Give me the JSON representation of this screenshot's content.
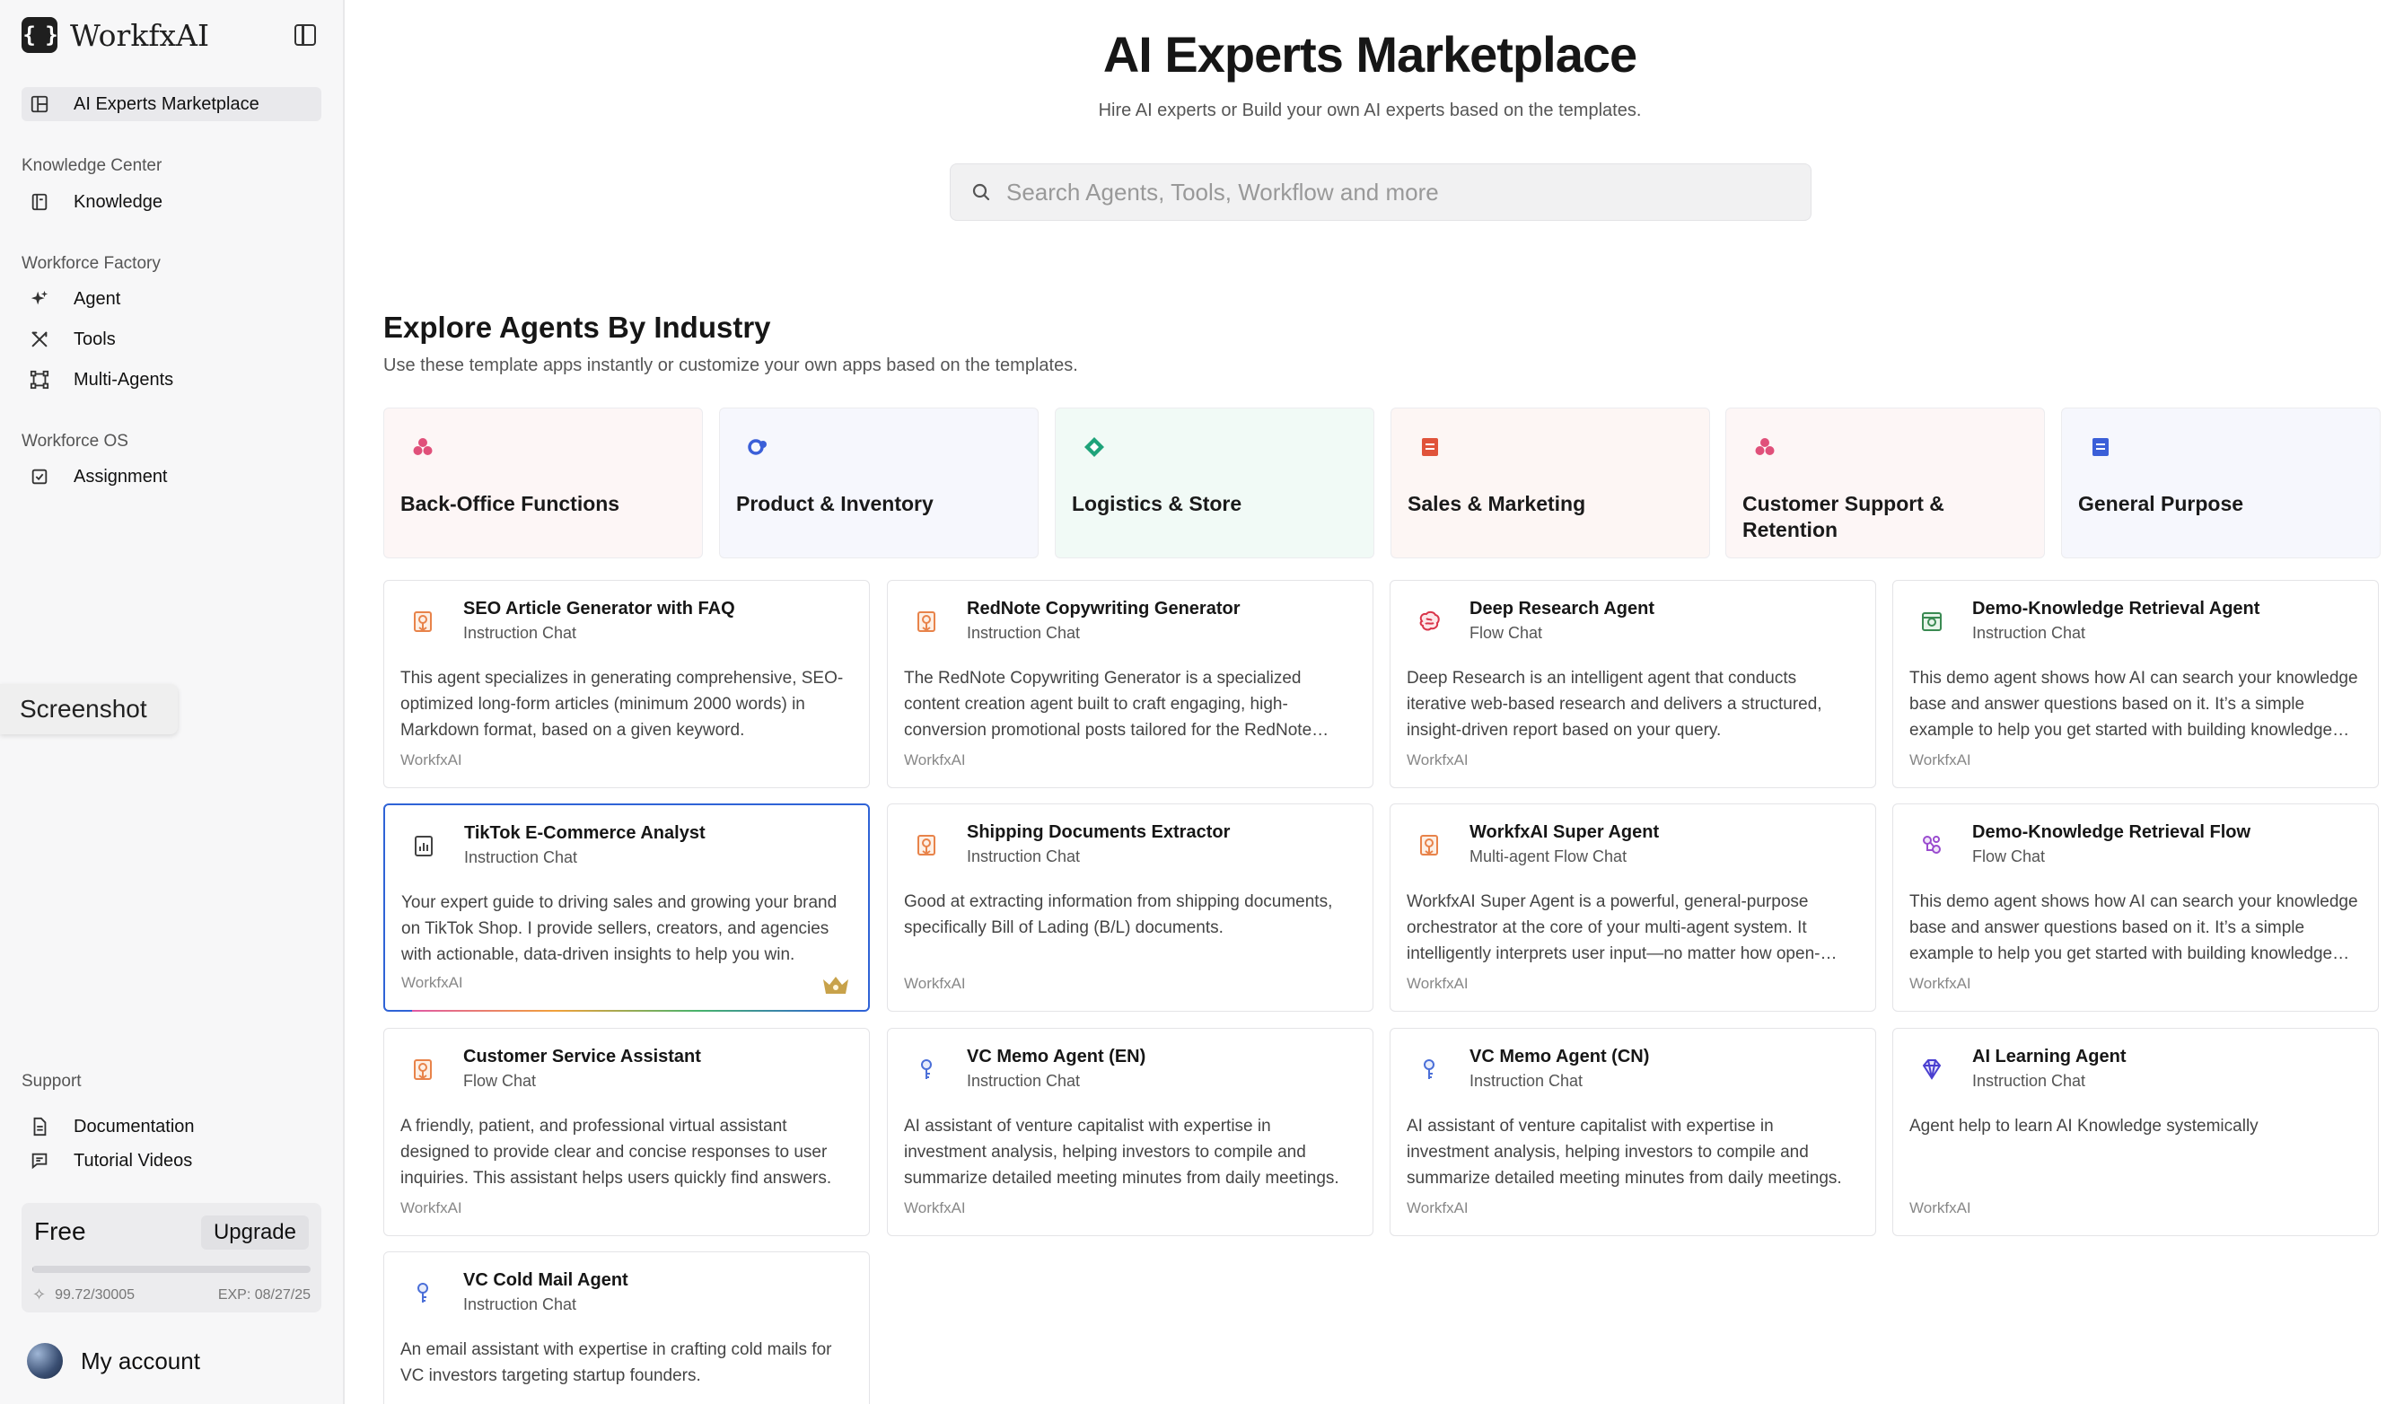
{
  "app": {
    "name": "WorkfxAI",
    "logo_text": "{ }"
  },
  "sidebar": {
    "active_item": "AI Experts Marketplace",
    "sections": [
      {
        "title": "Knowledge Center",
        "items": [
          "Knowledge"
        ]
      },
      {
        "title": "Workforce Factory",
        "items": [
          "Agent",
          "Tools",
          "Multi-Agents"
        ]
      },
      {
        "title": "Workforce OS",
        "items": [
          "Assignment"
        ]
      },
      {
        "title": "Support",
        "items": [
          "Documentation",
          "Tutorial Videos"
        ]
      }
    ],
    "screenshot_tab": "Screenshot",
    "plan": {
      "name": "Free",
      "upgrade_label": "Upgrade",
      "usage": "99.72/30005",
      "usage_fraction": 0.0033,
      "expiry": "EXP: 08/27/25"
    },
    "account_label": "My account"
  },
  "main": {
    "title": "AI Experts Marketplace",
    "subtitle": "Hire AI experts or Build your own AI experts based on the templates.",
    "search_placeholder": "Search Agents, Tools, Workflow and more",
    "industry_heading": "Explore Agents By Industry",
    "industry_desc": "Use these template apps instantly or customize your own apps based on the templates.",
    "industries": [
      {
        "name": "Back-Office Functions",
        "icon": "cluster-icon",
        "color": "#e0507a",
        "bg": "#fdf6f6"
      },
      {
        "name": "Product & Inventory",
        "icon": "gears-icon",
        "color": "#3b5fd8",
        "bg": "#f6f7fd"
      },
      {
        "name": "Logistics & Store",
        "icon": "diamond-icon",
        "color": "#1fa37a",
        "bg": "#f1faf6"
      },
      {
        "name": "Sales & Marketing",
        "icon": "document-icon",
        "color": "#e0533a",
        "bg": "#fdf6f4"
      },
      {
        "name": "Customer Support & Retention",
        "icon": "cluster-icon",
        "color": "#e0507a",
        "bg": "#fdf6f6"
      },
      {
        "name": "General Purpose",
        "icon": "document-icon",
        "color": "#3b5fd8",
        "bg": "#f6f7fd"
      }
    ],
    "agents": [
      {
        "title": "SEO Article Generator with FAQ",
        "type": "Instruction Chat",
        "desc": "This agent specializes in generating comprehensive, SEO-optimized long-form articles (minimum 2000 words) in Markdown format, based on a given keyword.",
        "author": "WorkfxAI",
        "icon": "writing-icon",
        "color": "#e8834a"
      },
      {
        "title": "RedNote Copywriting Generator",
        "type": "Instruction Chat",
        "desc": "The RedNote Copywriting Generator is a specialized content creation agent built to craft engaging, high-conversion promotional posts tailored for the RedNote platform.",
        "author": "WorkfxAI",
        "icon": "writing-icon",
        "color": "#e8834a"
      },
      {
        "title": "Deep Research Agent",
        "type": "Flow Chat",
        "desc": "Deep Research is an intelligent agent that conducts iterative web-based research and delivers a structured, insight-driven report based on your query.",
        "author": "WorkfxAI",
        "icon": "brain-icon",
        "color": "#d9354a"
      },
      {
        "title": "Demo-Knowledge Retrieval Agent",
        "type": "Instruction Chat",
        "desc": "This demo agent shows how AI can search your knowledge base and answer questions based on it. It’s a simple example to help you get started with building knowledge agents.",
        "author": "WorkfxAI",
        "icon": "folder-icon",
        "color": "#3a8a52"
      },
      {
        "title": "TikTok E-Commerce Analyst",
        "type": "Instruction Chat",
        "desc": "Your expert guide to driving sales and growing your brand on TikTok Shop. I provide sellers, creators, and agencies with actionable, data-driven insights to help you win.",
        "author": "WorkfxAI",
        "icon": "chart-icon",
        "color": "#444444",
        "featured": true
      },
      {
        "title": "Shipping Documents Extractor",
        "type": "Instruction Chat",
        "desc": "Good at extracting information from shipping documents, specifically Bill of Lading (B/L) documents.",
        "author": "WorkfxAI",
        "icon": "writing-icon",
        "color": "#e8834a"
      },
      {
        "title": "WorkfxAI Super Agent",
        "type": "Multi-agent Flow Chat",
        "desc": "WorkfxAI Super Agent is a powerful, general-purpose orchestrator at the core of your multi-agent system. It intelligently interprets user input—no matter how open-ended—and routes tasks.",
        "author": "WorkfxAI",
        "icon": "writing-icon",
        "color": "#e8834a"
      },
      {
        "title": "Demo-Knowledge Retrieval Flow",
        "type": "Flow Chat",
        "desc": "This demo agent shows how AI can search your knowledge base and answer questions based on it. It’s a simple example to help you get started with building knowledge flows.",
        "author": "WorkfxAI",
        "icon": "flow-icon",
        "color": "#9a4ccf"
      },
      {
        "title": "Customer Service Assistant",
        "type": "Flow Chat",
        "desc": "A friendly, patient, and professional virtual assistant designed to provide clear and concise responses to user inquiries. This assistant helps users quickly find answers.",
        "author": "WorkfxAI",
        "icon": "writing-icon",
        "color": "#e8834a"
      },
      {
        "title": "VC Memo Agent (EN)",
        "type": "Instruction Chat",
        "desc": "AI assistant of venture capitalist with expertise in investment analysis, helping investors to compile and summarize detailed meeting minutes from daily meetings.",
        "author": "WorkfxAI",
        "icon": "key-icon",
        "color": "#4b6fd8"
      },
      {
        "title": "VC Memo Agent (CN)",
        "type": "Instruction Chat",
        "desc": "AI assistant of venture capitalist with expertise in investment analysis, helping investors to compile and summarize detailed meeting minutes from daily meetings.",
        "author": "WorkfxAI",
        "icon": "key-icon",
        "color": "#4b6fd8"
      },
      {
        "title": "AI Learning Agent",
        "type": "Instruction Chat",
        "desc": "Agent help to learn AI Knowledge systemically",
        "author": "WorkfxAI",
        "icon": "gem-icon",
        "color": "#4a3fd0"
      },
      {
        "title": "VC Cold Mail Agent",
        "type": "Instruction Chat",
        "desc": "An email assistant with expertise in crafting cold mails for VC investors targeting startup founders.",
        "author": "WorkfxAI",
        "icon": "key-icon",
        "color": "#4b6fd8"
      }
    ]
  }
}
